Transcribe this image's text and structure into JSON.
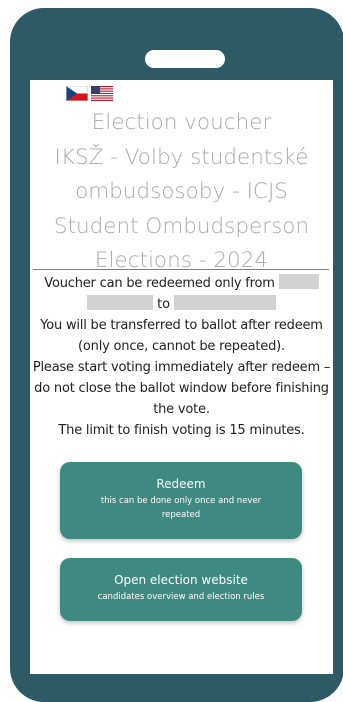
{
  "languages": [
    {
      "code": "cs",
      "icon": "czech-flag-icon"
    },
    {
      "code": "en",
      "icon": "us-flag-icon"
    }
  ],
  "title_lines": [
    "Election voucher",
    "IKSŽ - Volby studentské",
    "ombudsosoby - ICJS",
    "Student Ombudsperson",
    "Elections - 2024"
  ],
  "info": {
    "redeem_from_prefix": "Voucher can be redeemed only from",
    "redeem_to": "to",
    "transferred": "You will be transferred to ballot after redeem (only once, cannot be repeated).",
    "start_voting": "Please start voting immediately after redeem – do not close the ballot window before finishing the vote.",
    "limit": "The limit to finish voting is 15 minutes."
  },
  "buttons": {
    "redeem": {
      "label": "Redeem",
      "sublabel": "this can be done only once and never repeated"
    },
    "open_website": {
      "label": "Open election website",
      "sublabel": "candidates overview and election rules"
    }
  },
  "colors": {
    "phone_frame": "#2e5a66",
    "button": "#3f8a80",
    "title_text": "#a9a9a9",
    "redaction": "#d2d2d2"
  }
}
